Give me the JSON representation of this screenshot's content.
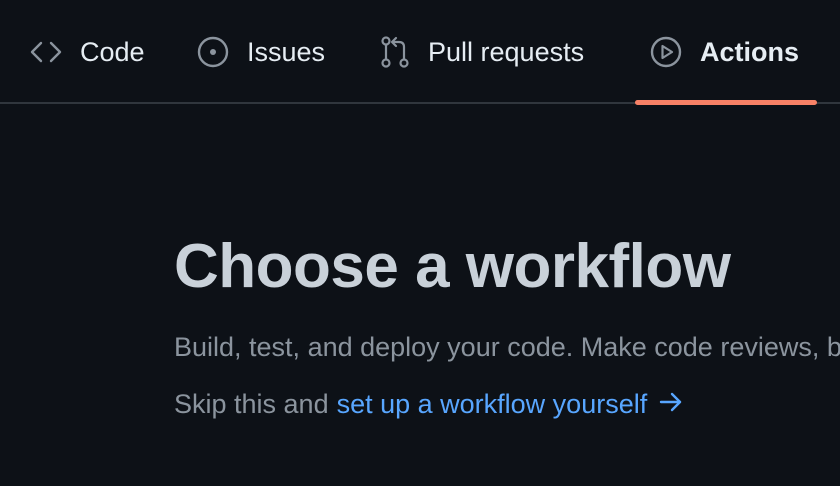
{
  "nav": {
    "tabs": [
      {
        "label": "Code",
        "icon": "code-icon"
      },
      {
        "label": "Issues",
        "icon": "issue-opened-icon"
      },
      {
        "label": "Pull requests",
        "icon": "git-pull-request-icon"
      },
      {
        "label": "Actions",
        "icon": "play-icon",
        "selected": true
      }
    ]
  },
  "main": {
    "title": "Choose a workflow",
    "subtitle": "Build, test, and deploy your code. Make code reviews, branch management, and issue triaging work the way you want.",
    "skip_prefix": "Skip this and",
    "skip_link": "set up a workflow yourself"
  },
  "colors": {
    "background": "#0d1117",
    "text": "#e6edf3",
    "muted": "#8b949e",
    "link": "#58a6ff",
    "accent": "#f78166",
    "border": "#30363d"
  }
}
